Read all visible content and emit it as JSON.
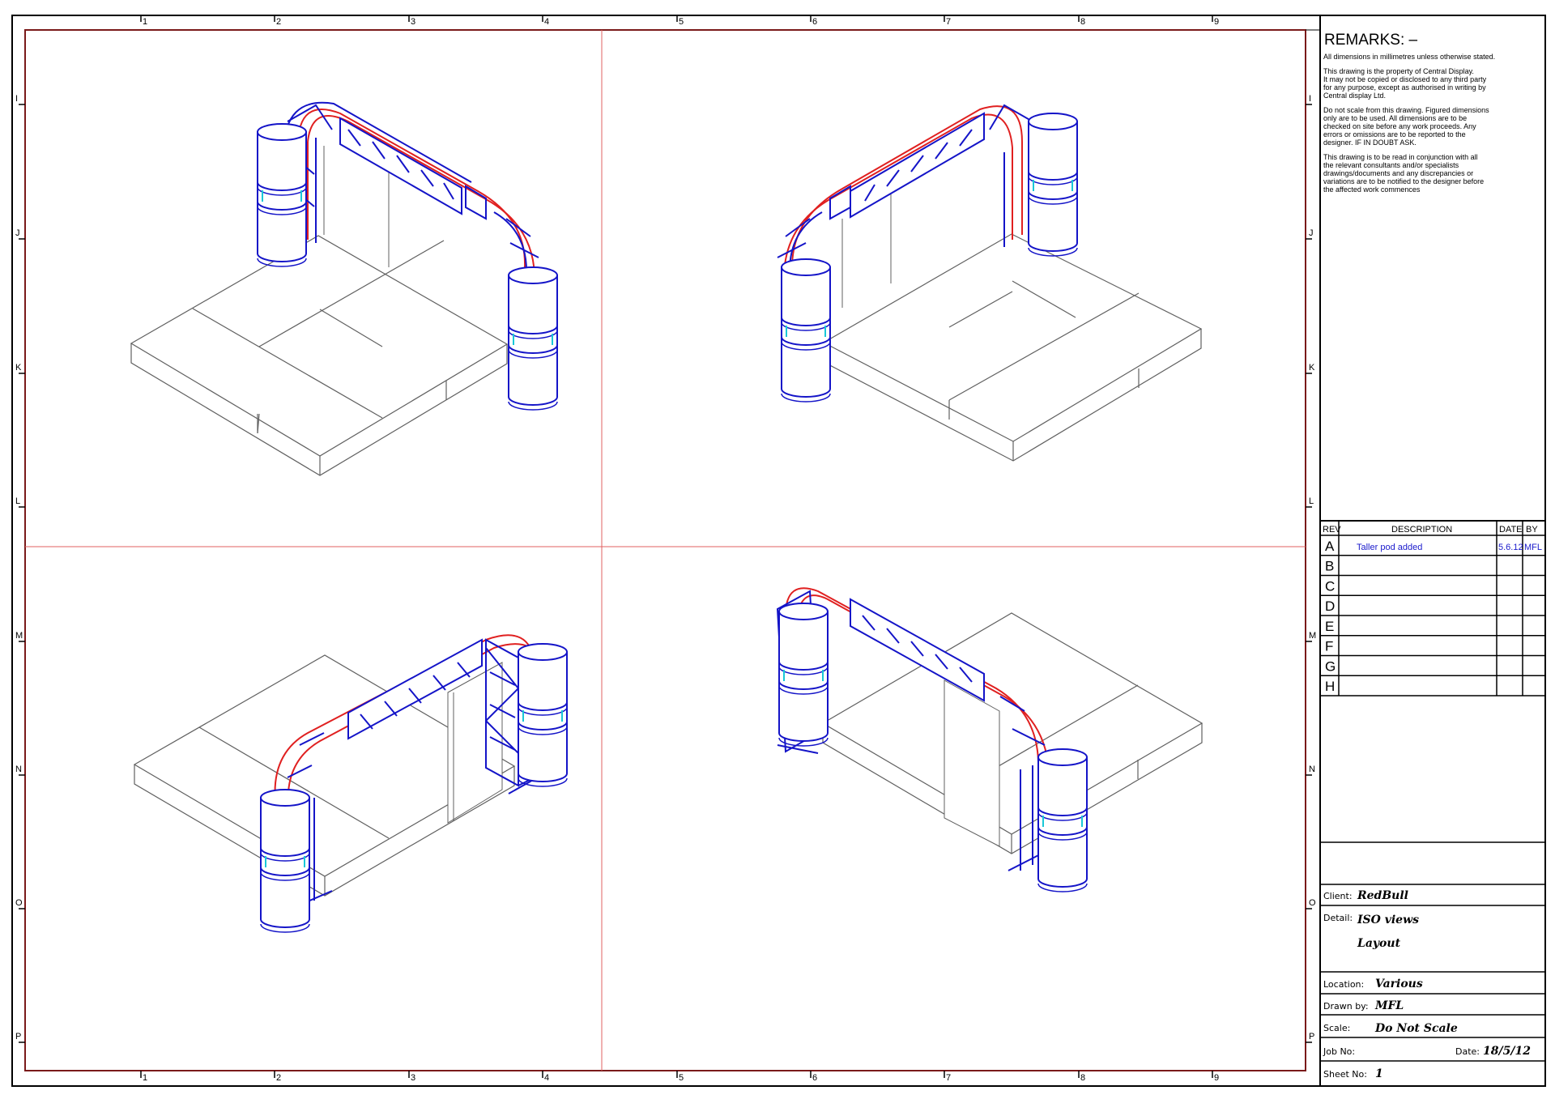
{
  "grid": {
    "columns": [
      "1",
      "2",
      "3",
      "4",
      "5",
      "6",
      "7",
      "8",
      "9"
    ],
    "rows": [
      "I",
      "J",
      "K",
      "L",
      "M",
      "N",
      "O",
      "P"
    ]
  },
  "remarks": {
    "title": "REMARKS: –",
    "paragraphs": [
      [
        "All dimensions in millimetres unless otherwise stated."
      ],
      [
        "This drawing is the property of Central Display.",
        "It may not be copied or disclosed to any third party",
        "for any purpose, except as authorised in writing by",
        "Central display Ltd."
      ],
      [
        "Do not scale from this drawing. Figured dimensions",
        "only are to be used. All dimensions are to be",
        "checked on site before any work proceeds. Any",
        "errors or omissions are to be reported to the",
        "designer. IF IN DOUBT ASK."
      ],
      [
        "This drawing is to be read in conjunction with all",
        "the relevant consultants and/or specialists",
        "drawings/documents and any discrepancies or",
        "variations are to be notified to the designer before",
        "the affected work commences"
      ]
    ]
  },
  "revisions": {
    "headers": {
      "rev": "REV",
      "description": "DESCRIPTION",
      "date": "DATE",
      "by": "BY"
    },
    "rows": [
      {
        "rev": "A",
        "description": "Taller pod added",
        "date": "5.6.12",
        "by": "MFL"
      },
      {
        "rev": "B",
        "description": "",
        "date": "",
        "by": ""
      },
      {
        "rev": "C",
        "description": "",
        "date": "",
        "by": ""
      },
      {
        "rev": "D",
        "description": "",
        "date": "",
        "by": ""
      },
      {
        "rev": "E",
        "description": "",
        "date": "",
        "by": ""
      },
      {
        "rev": "F",
        "description": "",
        "date": "",
        "by": ""
      },
      {
        "rev": "G",
        "description": "",
        "date": "",
        "by": ""
      },
      {
        "rev": "H",
        "description": "",
        "date": "",
        "by": ""
      }
    ]
  },
  "title_block": {
    "client_label": "Client:",
    "client": "RedBull",
    "detail_label": "Detail:",
    "detail_line1": "ISO views",
    "detail_line2": "Layout",
    "location_label": "Location:",
    "location": "Various",
    "drawn_by_label": "Drawn by:",
    "drawn_by": "MFL",
    "scale_label": "Scale:",
    "scale": "Do Not Scale",
    "job_no_label": "Job No:",
    "job_no": "",
    "date_label": "Date:",
    "date": "18/5/12",
    "sheet_no_label": "Sheet No:",
    "sheet_no": "1"
  },
  "colors": {
    "border": "#000000",
    "inner_border": "#7a1a1a",
    "centerline": "#e06060",
    "truss_blue": "#1414c8",
    "truss_red": "#e02020",
    "cyan": "#19c8d8",
    "floor": "#606060"
  }
}
